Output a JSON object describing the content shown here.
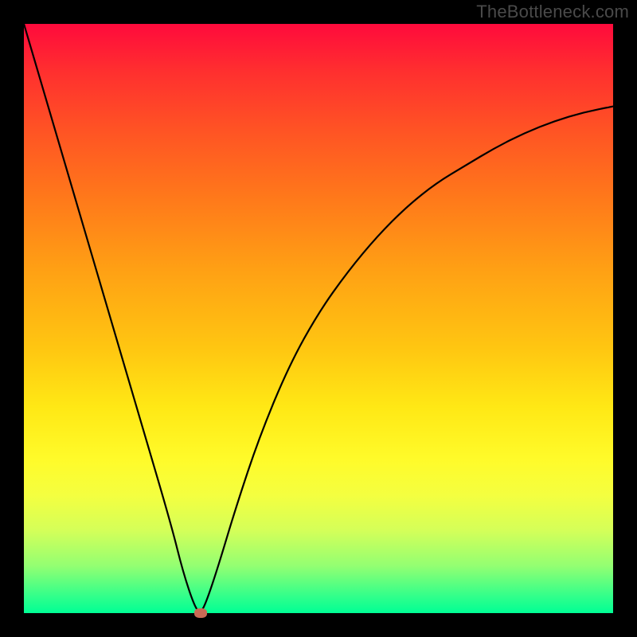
{
  "watermark": "TheBottleneck.com",
  "chart_data": {
    "type": "line",
    "title": "",
    "xlabel": "",
    "ylabel": "",
    "xlim": [
      0,
      100
    ],
    "ylim": [
      0,
      100
    ],
    "grid": false,
    "legend": false,
    "background_gradient": {
      "top": "#ff0a3c",
      "middle": "#ffe815",
      "bottom": "#00ff95"
    },
    "series": [
      {
        "name": "bottleneck-curve",
        "x": [
          0,
          5,
          10,
          15,
          20,
          25,
          27,
          29,
          30,
          31,
          33,
          36,
          40,
          45,
          50,
          55,
          60,
          65,
          70,
          75,
          80,
          85,
          90,
          95,
          100
        ],
        "y": [
          100,
          83,
          66,
          49,
          32,
          15,
          7,
          1,
          0,
          2,
          8,
          18,
          30,
          42,
          51,
          58,
          64,
          69,
          73,
          76,
          79,
          81.5,
          83.5,
          85,
          86
        ]
      }
    ],
    "marker": {
      "name": "optimal-point",
      "x": 30,
      "y": 0,
      "color": "#c96a55"
    }
  }
}
